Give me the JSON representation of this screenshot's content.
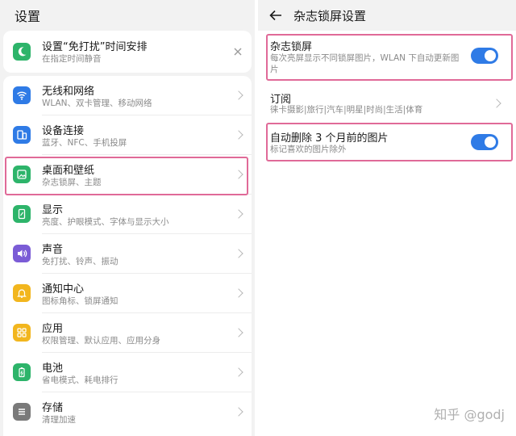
{
  "left": {
    "header_title": "设置",
    "notice": {
      "title": "设置“免打扰”时间安排",
      "subtitle": "在指定时间静音",
      "icon": "moon-icon",
      "accent": "#2db46a"
    },
    "items": [
      {
        "title": "无线和网络",
        "subtitle": "WLAN、双卡管理、移动网络",
        "icon": "wifi-icon",
        "color": "#2f7be6"
      },
      {
        "title": "设备连接",
        "subtitle": "蓝牙、NFC、手机投屏",
        "icon": "devices-icon",
        "color": "#2f7be6"
      },
      {
        "title": "桌面和壁纸",
        "subtitle": "杂志锁屏、主题",
        "icon": "wallpaper-icon",
        "color": "#2db46a"
      },
      {
        "title": "显示",
        "subtitle": "亮度、护眼模式、字体与显示大小",
        "icon": "display-icon",
        "color": "#2db46a"
      },
      {
        "title": "声音",
        "subtitle": "免打扰、铃声、振动",
        "icon": "sound-icon",
        "color": "#7b5cd6"
      },
      {
        "title": "通知中心",
        "subtitle": "图标角标、锁屏通知",
        "icon": "bell-icon",
        "color": "#f2b61e"
      },
      {
        "title": "应用",
        "subtitle": "权限管理、默认应用、应用分身",
        "icon": "apps-icon",
        "color": "#f2b61e"
      },
      {
        "title": "电池",
        "subtitle": "省电模式、耗电排行",
        "icon": "battery-icon",
        "color": "#2db46a"
      },
      {
        "title": "存储",
        "subtitle": "清理加速",
        "icon": "storage-icon",
        "color": "#7a7a7a"
      }
    ]
  },
  "right": {
    "header_title": "杂志锁屏设置",
    "magazine": {
      "title": "杂志锁屏",
      "subtitle": "每次亮屏显示不同锁屏图片，WLAN 下自动更新图片",
      "on": true
    },
    "subscribe": {
      "title": "订阅",
      "subtitle": "徕卡摄影|旅行|汽车|明星|时尚|生活|体育"
    },
    "auto_delete": {
      "title": "自动删除 3 个月前的图片",
      "subtitle": "标记喜欢的图片除外",
      "on": true
    },
    "watermark": "知乎 @godj"
  },
  "colors": {
    "highlight": "#e06a98",
    "toggle_on": "#2f7be6"
  }
}
